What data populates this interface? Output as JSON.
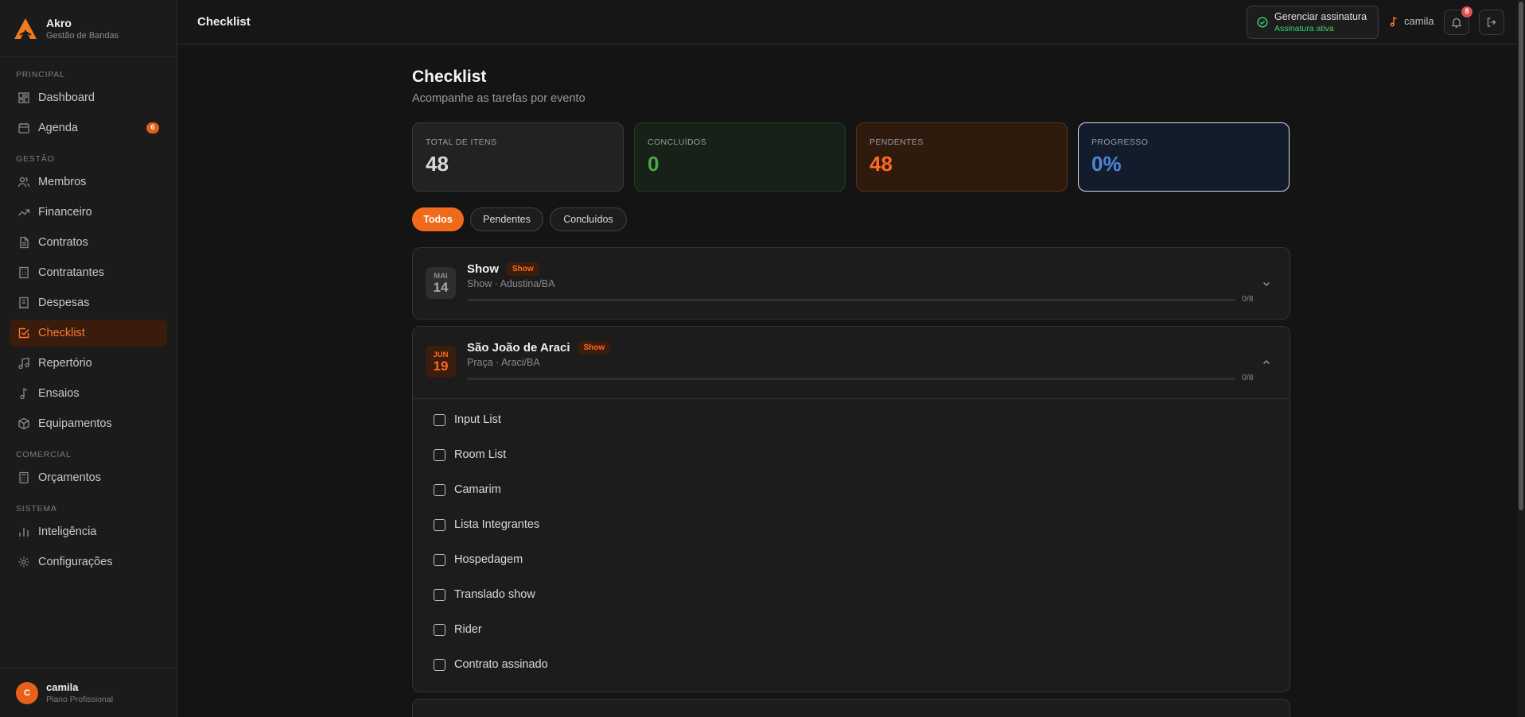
{
  "brand": {
    "name": "Akro",
    "subtitle": "Gestão de Bandas"
  },
  "sidebar": {
    "sections": [
      {
        "title": "PRINCIPAL",
        "items": [
          {
            "label": "Dashboard",
            "icon": "grid-icon"
          },
          {
            "label": "Agenda",
            "icon": "calendar-icon",
            "badge": "6"
          }
        ]
      },
      {
        "title": "GESTÃO",
        "items": [
          {
            "label": "Membros",
            "icon": "users-icon"
          },
          {
            "label": "Financeiro",
            "icon": "trending-up-icon"
          },
          {
            "label": "Contratos",
            "icon": "file-icon"
          },
          {
            "label": "Contratantes",
            "icon": "building-icon"
          },
          {
            "label": "Despesas",
            "icon": "receipt-icon"
          },
          {
            "label": "Checklist",
            "icon": "checkbox-icon",
            "active": true
          },
          {
            "label": "Repertório",
            "icon": "music-icon"
          },
          {
            "label": "Ensaios",
            "icon": "music-note-icon"
          },
          {
            "label": "Equipamentos",
            "icon": "box-icon"
          }
        ]
      },
      {
        "title": "COMERCIAL",
        "items": [
          {
            "label": "Orçamentos",
            "icon": "calculator-icon"
          }
        ]
      },
      {
        "title": "SISTEMA",
        "items": [
          {
            "label": "Inteligência",
            "icon": "bar-chart-icon"
          },
          {
            "label": "Configurações",
            "icon": "gear-icon"
          }
        ]
      }
    ],
    "user": {
      "initial": "C",
      "name": "camila",
      "plan": "Plano Profissional"
    }
  },
  "topbar": {
    "title": "Checklist",
    "subscription": {
      "label": "Gerenciar assinatura",
      "status": "Assinatura ativa"
    },
    "username": "camila",
    "notifications": "8"
  },
  "page": {
    "title": "Checklist",
    "subtitle": "Acompanhe as tarefas por evento"
  },
  "stats": {
    "total": {
      "label": "TOTAL DE ITENS",
      "value": "48"
    },
    "done": {
      "label": "CONCLUÍDOS",
      "value": "0"
    },
    "pending": {
      "label": "PENDENTES",
      "value": "48"
    },
    "progress": {
      "label": "PROGRESSO",
      "value": "0%"
    }
  },
  "filters": {
    "all": "Todos",
    "pending": "Pendentes",
    "done": "Concluídos"
  },
  "events": [
    {
      "month": "MAI",
      "day": "14",
      "name": "Show",
      "tag": "Show",
      "subtitle": "Show · Adustina/BA",
      "count": "0/8",
      "progress": 0,
      "expanded": false
    },
    {
      "month": "JUN",
      "day": "19",
      "name": "São João de Araci",
      "tag": "Show",
      "subtitle": "Praça · Araci/BA",
      "count": "0/8",
      "progress": 0,
      "expanded": true,
      "items": [
        "Input List",
        "Room List",
        "Camarim",
        "Lista Integrantes",
        "Hospedagem",
        "Translado show",
        "Rider",
        "Contrato assinado"
      ]
    }
  ],
  "colors": {
    "accent": "#f06a1c",
    "success": "#4ca64c",
    "info": "#4e86d9",
    "background": "#141414"
  }
}
